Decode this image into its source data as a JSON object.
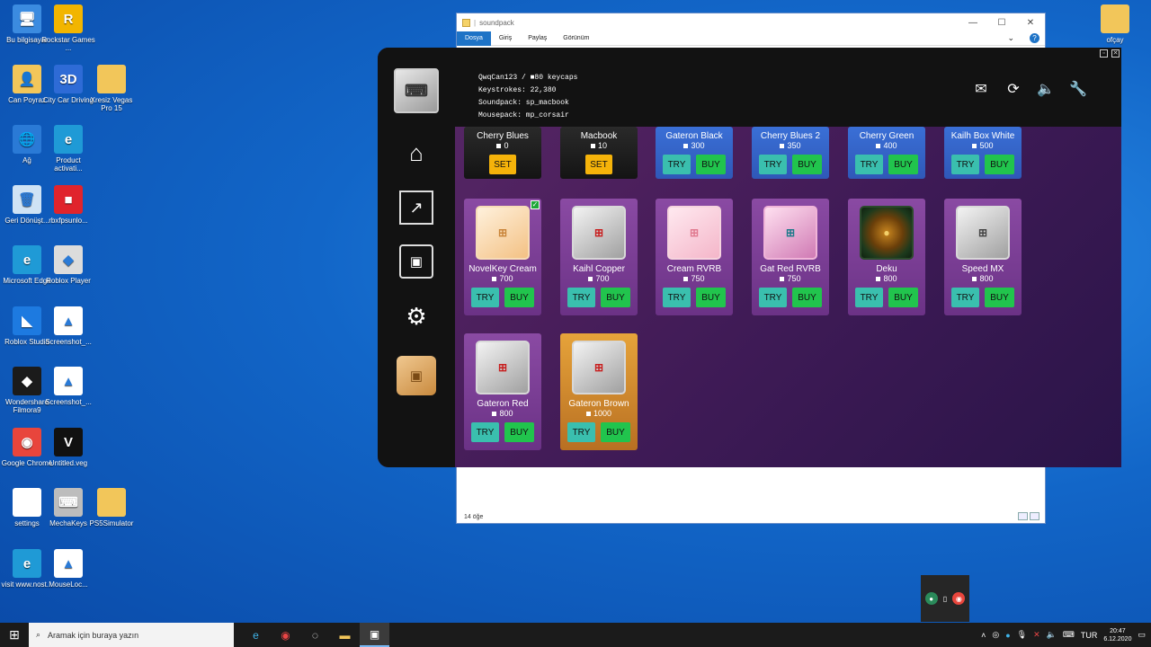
{
  "desktop": {
    "icons": [
      {
        "label": "Bu bilgisayar",
        "icon": "computer-icon",
        "glyph": "🖥",
        "bg": "#3b8be0"
      },
      {
        "label": "Rockstar Games ...",
        "icon": "rockstar-icon",
        "glyph": "R",
        "bg": "#f2b500"
      },
      {
        "label": "Can Poyraz",
        "icon": "user-folder-icon",
        "glyph": "👤",
        "bg": "#f2c65a"
      },
      {
        "label": "City Car Driving",
        "icon": "city-car-icon",
        "glyph": "3D",
        "bg": "#2e6bd6"
      },
      {
        "label": "Xresiz Vegas Pro 15",
        "icon": "folder-icon",
        "glyph": "",
        "bg": "#f2c65a"
      },
      {
        "label": "Ağ",
        "icon": "network-icon",
        "glyph": "🌐",
        "bg": "#2a7ad6"
      },
      {
        "label": "Product activati...",
        "icon": "edge-icon",
        "glyph": "e",
        "bg": "#1f9ad6"
      },
      {
        "label": "Geri Dönüşt...",
        "icon": "recycle-bin-icon",
        "glyph": "🗑",
        "bg": "#cfe3f5"
      },
      {
        "label": "rbxfpsunlo...",
        "icon": "roblox-lock-icon",
        "glyph": "■",
        "bg": "#e0242c"
      },
      {
        "label": "Microsoft Edge",
        "icon": "edge-icon",
        "glyph": "e",
        "bg": "#1f9ad6"
      },
      {
        "label": "Roblox Player",
        "icon": "roblox-icon",
        "glyph": "◆",
        "bg": "#dcdcdc"
      },
      {
        "label": "Roblox Studio",
        "icon": "roblox-studio-icon",
        "glyph": "◣",
        "bg": "#1d7ae0"
      },
      {
        "label": "Screenshot_...",
        "icon": "image-file-icon",
        "glyph": "▲",
        "bg": "#ffffff"
      },
      {
        "label": "Wondershare Filmora9",
        "icon": "filmora-icon",
        "glyph": "◆",
        "bg": "#1b1b1b"
      },
      {
        "label": "Screenshot_...",
        "icon": "image-file-icon",
        "glyph": "▲",
        "bg": "#ffffff"
      },
      {
        "label": "Google Chrome",
        "icon": "chrome-icon",
        "glyph": "◉",
        "bg": "#e8453c"
      },
      {
        "label": "Untitled.veg",
        "icon": "vegas-file-icon",
        "glyph": "V",
        "bg": "#111111"
      },
      {
        "label": "settings",
        "icon": "text-file-icon",
        "glyph": "",
        "bg": "#ffffff"
      },
      {
        "label": "MechaKeys",
        "icon": "mechakeys-icon",
        "glyph": "⌨",
        "bg": "#bdbdbd"
      },
      {
        "label": "PS5Simulator",
        "icon": "folder-icon",
        "glyph": "",
        "bg": "#f2c65a"
      },
      {
        "label": "visit www.nost...",
        "icon": "edge-icon",
        "glyph": "e",
        "bg": "#1f9ad6"
      },
      {
        "label": "MouseLoc...",
        "icon": "image-file-icon",
        "glyph": "▲",
        "bg": "#ffffff"
      },
      {
        "label": "ofçay",
        "icon": "folder-icon",
        "glyph": "",
        "bg": "#f2c65a"
      }
    ]
  },
  "explorer": {
    "title": "soundpack",
    "tabs": [
      "Dosya",
      "Giriş",
      "Paylaş",
      "Görünüm"
    ],
    "status": "14 öğe"
  },
  "app": {
    "stats": {
      "line1": "QwqCan123 / ■80 keycaps",
      "line2": "Keystrokes: 22,380",
      "line3": "Soundpack: sp_macbook",
      "line4": "Mousepack: mp_corsair"
    },
    "cards_row1": [
      {
        "name": "Cherry Blues",
        "price": "0",
        "style": "owned",
        "action": "SET"
      },
      {
        "name": "Macbook",
        "price": "10",
        "style": "owned",
        "action": "SET"
      },
      {
        "name": "Gateron Black",
        "price": "300",
        "style": "blue",
        "action": "TRYBUY"
      },
      {
        "name": "Cherry Blues 2",
        "price": "350",
        "style": "blue",
        "action": "TRYBUY"
      },
      {
        "name": "Cherry Green",
        "price": "400",
        "style": "blue",
        "action": "TRYBUY"
      },
      {
        "name": "Kailh Box White",
        "price": "500",
        "style": "blue",
        "action": "TRYBUY"
      }
    ],
    "cards_row2": [
      {
        "name": "NovelKey Cream",
        "price": "700",
        "cap": "cream",
        "checked": true
      },
      {
        "name": "Kaihl Copper",
        "price": "700",
        "cap": "red"
      },
      {
        "name": "Cream RVRB",
        "price": "750",
        "cap": "pink"
      },
      {
        "name": "Gat Red RVRB",
        "price": "750",
        "cap": "teal"
      },
      {
        "name": "Deku",
        "price": "800",
        "cap": "dark"
      },
      {
        "name": "Speed MX",
        "price": "800",
        "cap": ""
      }
    ],
    "cards_row3": [
      {
        "name": "Gateron Red",
        "price": "800",
        "cap": "red",
        "style": ""
      },
      {
        "name": "Gateron Brown",
        "price": "1000",
        "cap": "red",
        "style": "gold"
      }
    ],
    "labels": {
      "try": "TRY",
      "buy": "BUY",
      "set": "SET"
    }
  },
  "taskbar": {
    "search_placeholder": "Aramak için buraya yazın",
    "language": "TUR",
    "time": "20:47",
    "date": "6.12.2020"
  },
  "colors": {
    "try": "#3abfae",
    "buy": "#21c44d",
    "set": "#f5b30a",
    "card_purple": "#8a4aa3",
    "card_blue": "#3a6fd6"
  }
}
